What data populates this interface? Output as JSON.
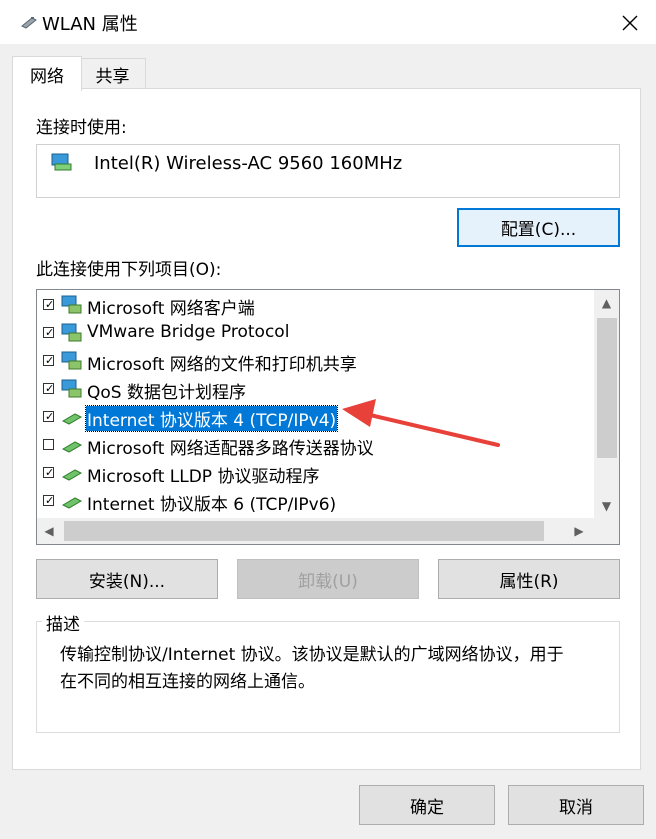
{
  "window": {
    "title": "WLAN 属性",
    "close_glyph": "✕"
  },
  "tabs": [
    {
      "label": "网络",
      "active": true
    },
    {
      "label": "共享",
      "active": false
    }
  ],
  "connect_using": {
    "label": "连接时使用:",
    "adapter_name": "Intel(R) Wireless-AC 9560 160MHz",
    "configure_button": "配置(C)..."
  },
  "items_section": {
    "label": "此连接使用下列项目(O):",
    "items": [
      {
        "label": "Microsoft 网络客户端",
        "checked": true,
        "icon": "network-client-icon",
        "selected": false
      },
      {
        "label": "VMware Bridge Protocol",
        "checked": true,
        "icon": "network-client-icon",
        "selected": false
      },
      {
        "label": "Microsoft 网络的文件和打印机共享",
        "checked": true,
        "icon": "network-client-icon",
        "selected": false
      },
      {
        "label": "QoS 数据包计划程序",
        "checked": true,
        "icon": "network-client-icon",
        "selected": false
      },
      {
        "label": "Internet 协议版本 4 (TCP/IPv4)",
        "checked": true,
        "icon": "protocol-icon",
        "selected": true
      },
      {
        "label": "Microsoft 网络适配器多路传送器协议",
        "checked": false,
        "icon": "protocol-icon",
        "selected": false
      },
      {
        "label": "Microsoft LLDP 协议驱动程序",
        "checked": true,
        "icon": "protocol-icon",
        "selected": false
      },
      {
        "label": "Internet 协议版本 6 (TCP/IPv6)",
        "checked": true,
        "icon": "protocol-icon",
        "selected": false
      }
    ]
  },
  "action_buttons": {
    "install": "安装(N)...",
    "uninstall": "卸载(U)",
    "properties": "属性(R)"
  },
  "description": {
    "title": "描述",
    "text_line1": "传输控制协议/Internet 协议。该协议是默认的广域网络协议，用于",
    "text_line2": "在不同的相互连接的网络上通信。"
  },
  "footer": {
    "ok": "确定",
    "cancel": "取消"
  },
  "colors": {
    "selection": "#0078d7",
    "annotation_arrow": "#e8413a"
  }
}
